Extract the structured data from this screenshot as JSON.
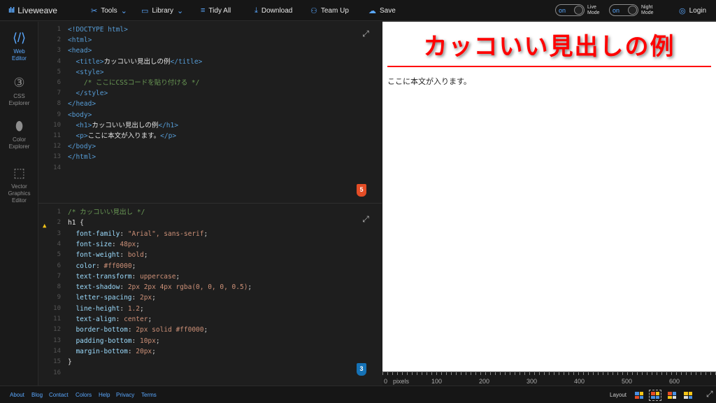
{
  "app": {
    "name": "Liveweave"
  },
  "toolbar": {
    "tools": "Tools",
    "library": "Library",
    "tidy": "Tidy All",
    "download": "Download",
    "team": "Team Up",
    "save": "Save",
    "live_toggle": "on",
    "live_label_1": "Live",
    "live_label_2": "Mode",
    "night_toggle": "on",
    "night_label_1": "Night",
    "night_label_2": "Mode",
    "login": "Login"
  },
  "sidebar": {
    "items": [
      {
        "line1": "Web",
        "line2": "Editor",
        "line3": "",
        "line4": "",
        "icon": "html-file-icon"
      },
      {
        "line1": "CSS",
        "line2": "Explorer",
        "line3": "",
        "line4": "",
        "icon": "css-icon"
      },
      {
        "line1": "Color",
        "line2": "Explorer",
        "line3": "",
        "line4": "",
        "icon": "droplet-icon"
      },
      {
        "line1": "Vector",
        "line2": "Graphics",
        "line3": "Editor",
        "line4": "",
        "icon": "vector-icon"
      }
    ]
  },
  "html_editor": {
    "badge": "5",
    "lines": [
      {
        "n": "1",
        "t": "<!DOCTYPE html>"
      },
      {
        "n": "2",
        "t": "<html>"
      },
      {
        "n": "3",
        "t": "<head>"
      },
      {
        "n": "4",
        "pre": "  <title>",
        "txt": "カッコいい見出しの例",
        "post": "</title>"
      },
      {
        "n": "5",
        "t": "  <style>"
      },
      {
        "n": "6",
        "c": "    /* ここにCSSコードを貼り付ける */"
      },
      {
        "n": "7",
        "t": "  </style>"
      },
      {
        "n": "8",
        "t": "</head>"
      },
      {
        "n": "9",
        "t": "<body>"
      },
      {
        "n": "10",
        "pre": "  <h1>",
        "txt": "カッコいい見出しの例",
        "post": "</h1>"
      },
      {
        "n": "11",
        "pre": "  <p>",
        "txt": "ここに本文が入ります。",
        "post": "</p>"
      },
      {
        "n": "12",
        "t": "</body>"
      },
      {
        "n": "13",
        "t": "</html>"
      },
      {
        "n": "14",
        "t": ""
      }
    ]
  },
  "css_editor": {
    "badge": "3",
    "warning_icon": "warning-icon",
    "lines": [
      {
        "n": "1",
        "c": "/* カッコいい見出し */"
      },
      {
        "n": "2",
        "sel": "h1 {"
      },
      {
        "n": "3",
        "p": "font-family",
        "v": "\"Arial\", sans-serif"
      },
      {
        "n": "4",
        "p": "font-size",
        "v": "48px"
      },
      {
        "n": "5",
        "p": "font-weight",
        "v": "bold"
      },
      {
        "n": "6",
        "p": "color",
        "v": "#ff0000"
      },
      {
        "n": "7",
        "p": "text-transform",
        "v": "uppercase"
      },
      {
        "n": "8",
        "p": "text-shadow",
        "v": "2px 2px 4px rgba(0, 0, 0, 0.5)"
      },
      {
        "n": "9",
        "p": "letter-spacing",
        "v": "2px"
      },
      {
        "n": "10",
        "p": "line-height",
        "v": "1.2"
      },
      {
        "n": "11",
        "p": "text-align",
        "v": "center"
      },
      {
        "n": "12",
        "p": "border-bottom",
        "v": "2px solid #ff0000"
      },
      {
        "n": "13",
        "p": "padding-bottom",
        "v": "10px"
      },
      {
        "n": "14",
        "p": "margin-bottom",
        "v": "20px"
      },
      {
        "n": "15",
        "sel": "}"
      },
      {
        "n": "16",
        "t": ""
      }
    ]
  },
  "preview": {
    "heading": "カッコいい見出しの例",
    "body": "ここに本文が入ります。"
  },
  "ruler": {
    "labels": [
      "0",
      "pixels",
      "100",
      "200",
      "300",
      "400",
      "500",
      "600"
    ]
  },
  "footer": {
    "links": [
      "About",
      "Blog",
      "Contact",
      "Colors",
      "Help",
      "Privacy",
      "Terms"
    ],
    "layout_label": "Layout"
  },
  "colors": {
    "accent": "#5aa8ff",
    "heading_red": "#ff0000",
    "html_badge": "#e44d26",
    "css_badge": "#1572b6"
  }
}
